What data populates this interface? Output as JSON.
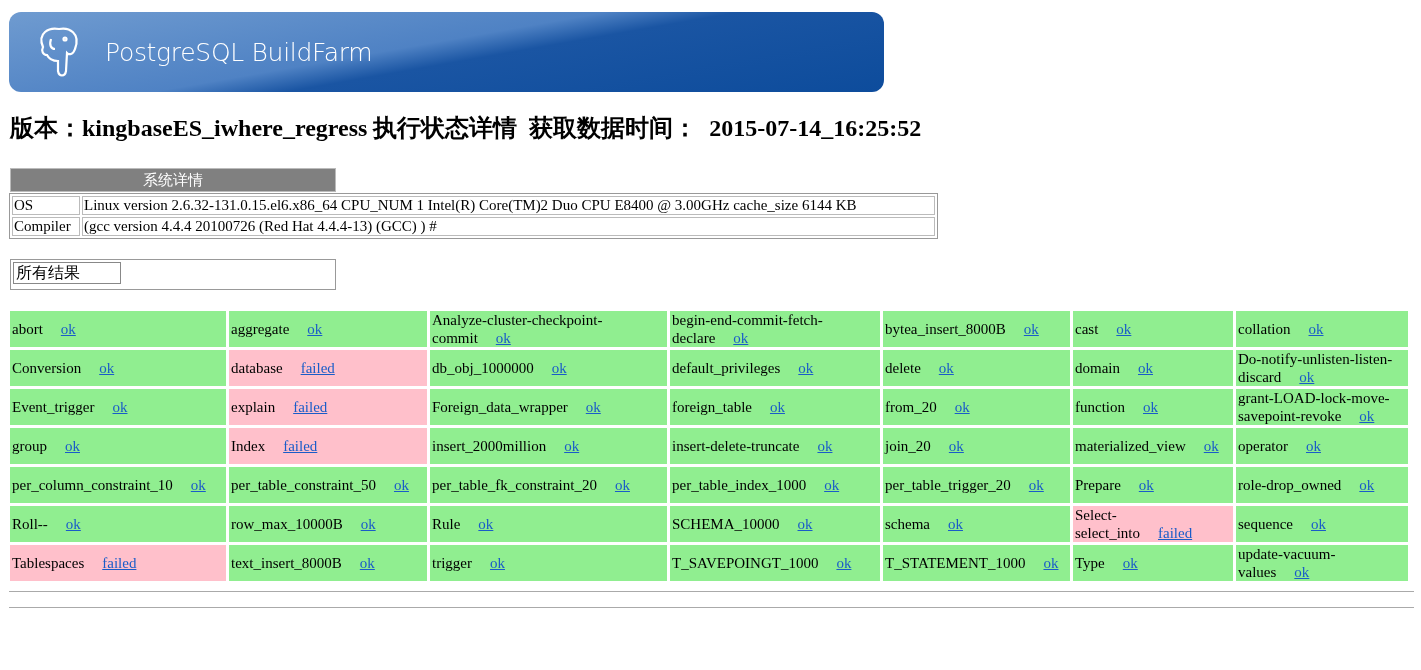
{
  "banner": {
    "title": "PostgreSQL BuildFarm"
  },
  "heading": "版本：kingbaseES_iwhere_regress 执行状态详情  获取数据时间：  2015-07-14_16:25:52",
  "system": {
    "title": "系统详情",
    "rows": [
      {
        "label": "OS",
        "value": "Linux version 2.6.32-131.0.15.el6.x86_64 CPU_NUM 1 Intel(R) Core(TM)2 Duo CPU E8400 @ 3.00GHz cache_size 6144 KB"
      },
      {
        "label": "Compiler",
        "value": "(gcc version 4.4.4 20100726 (Red Hat 4.4.4-13) (GCC) ) #"
      }
    ]
  },
  "filter": {
    "value": "所有结果"
  },
  "results": [
    [
      {
        "name": "abort",
        "status": "ok",
        "passed": true
      },
      {
        "name": "aggregate",
        "status": "ok",
        "passed": true
      },
      {
        "name": "Analyze-cluster-checkpoint-commit",
        "status": "ok",
        "passed": true
      },
      {
        "name": "begin-end-commit-fetch-declare",
        "status": "ok",
        "passed": true
      },
      {
        "name": "bytea_insert_8000B",
        "status": "ok",
        "passed": true
      },
      {
        "name": "cast",
        "status": "ok",
        "passed": true
      },
      {
        "name": "collation",
        "status": "ok",
        "passed": true
      }
    ],
    [
      {
        "name": "Conversion",
        "status": "ok",
        "passed": true
      },
      {
        "name": "database",
        "status": "failed",
        "passed": false
      },
      {
        "name": "db_obj_1000000",
        "status": "ok",
        "passed": true
      },
      {
        "name": "default_privileges",
        "status": "ok",
        "passed": true
      },
      {
        "name": "delete",
        "status": "ok",
        "passed": true
      },
      {
        "name": "domain",
        "status": "ok",
        "passed": true
      },
      {
        "name": "Do-notify-unlisten-listen-discard",
        "status": "ok",
        "passed": true
      }
    ],
    [
      {
        "name": "Event_trigger",
        "status": "ok",
        "passed": true
      },
      {
        "name": "explain",
        "status": "failed",
        "passed": false
      },
      {
        "name": "Foreign_data_wrapper",
        "status": "ok",
        "passed": true
      },
      {
        "name": "foreign_table",
        "status": "ok",
        "passed": true
      },
      {
        "name": "from_20",
        "status": "ok",
        "passed": true
      },
      {
        "name": "function",
        "status": "ok",
        "passed": true
      },
      {
        "name": "grant-LOAD-lock-move-savepoint-revoke",
        "status": "ok",
        "passed": true
      }
    ],
    [
      {
        "name": "group",
        "status": "ok",
        "passed": true
      },
      {
        "name": "Index",
        "status": "failed",
        "passed": false
      },
      {
        "name": "insert_2000million",
        "status": "ok",
        "passed": true
      },
      {
        "name": "insert-delete-truncate",
        "status": "ok",
        "passed": true
      },
      {
        "name": "join_20",
        "status": "ok",
        "passed": true
      },
      {
        "name": "materialized_view",
        "status": "ok",
        "passed": true
      },
      {
        "name": "operator",
        "status": "ok",
        "passed": true
      }
    ],
    [
      {
        "name": "per_column_constraint_10",
        "status": "ok",
        "passed": true
      },
      {
        "name": "per_table_constraint_50",
        "status": "ok",
        "passed": true
      },
      {
        "name": "per_table_fk_constraint_20",
        "status": "ok",
        "passed": true
      },
      {
        "name": "per_table_index_1000",
        "status": "ok",
        "passed": true
      },
      {
        "name": "per_table_trigger_20",
        "status": "ok",
        "passed": true
      },
      {
        "name": "Prepare",
        "status": "ok",
        "passed": true
      },
      {
        "name": "role-drop_owned",
        "status": "ok",
        "passed": true
      }
    ],
    [
      {
        "name": "Roll--",
        "status": "ok",
        "passed": true
      },
      {
        "name": "row_max_10000B",
        "status": "ok",
        "passed": true
      },
      {
        "name": "Rule",
        "status": "ok",
        "passed": true
      },
      {
        "name": "SCHEMA_10000",
        "status": "ok",
        "passed": true
      },
      {
        "name": "schema",
        "status": "ok",
        "passed": true
      },
      {
        "name": "Select-select_into",
        "status": "failed",
        "passed": false
      },
      {
        "name": "sequence",
        "status": "ok",
        "passed": true
      }
    ],
    [
      {
        "name": "Tablespaces",
        "status": "failed",
        "passed": false
      },
      {
        "name": "text_insert_8000B",
        "status": "ok",
        "passed": true
      },
      {
        "name": "trigger",
        "status": "ok",
        "passed": true
      },
      {
        "name": "T_SAVEPOINGT_1000",
        "status": "ok",
        "passed": true
      },
      {
        "name": "T_STATEMENT_1000",
        "status": "ok",
        "passed": true
      },
      {
        "name": "Type",
        "status": "ok",
        "passed": true
      },
      {
        "name": "update-vacuum-values",
        "status": "ok",
        "passed": true
      }
    ]
  ]
}
